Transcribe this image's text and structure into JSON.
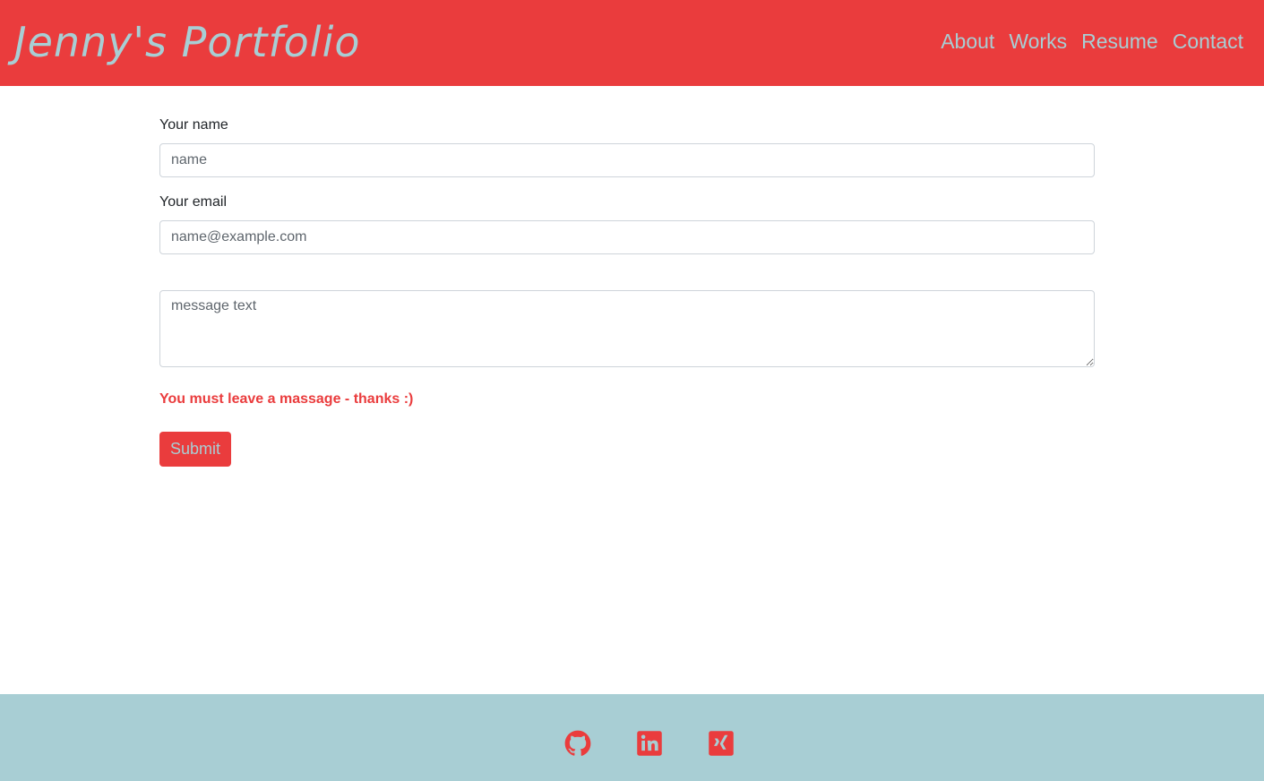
{
  "header": {
    "brand": "Jenny's Portfolio",
    "nav": [
      "About",
      "Works",
      "Resume",
      "Contact"
    ]
  },
  "form": {
    "name_label": "Your name",
    "name_placeholder": "name",
    "email_label": "Your email",
    "email_placeholder": "name@example.com",
    "message_placeholder": "message text",
    "error_text": "You must leave a massage - thanks :)",
    "submit_label": "Submit"
  },
  "footer": {
    "icons": [
      "github-icon",
      "linkedin-icon",
      "xing-icon"
    ]
  },
  "colors": {
    "primary_red": "#ea3c3d",
    "accent_blue": "#a8ced4"
  }
}
